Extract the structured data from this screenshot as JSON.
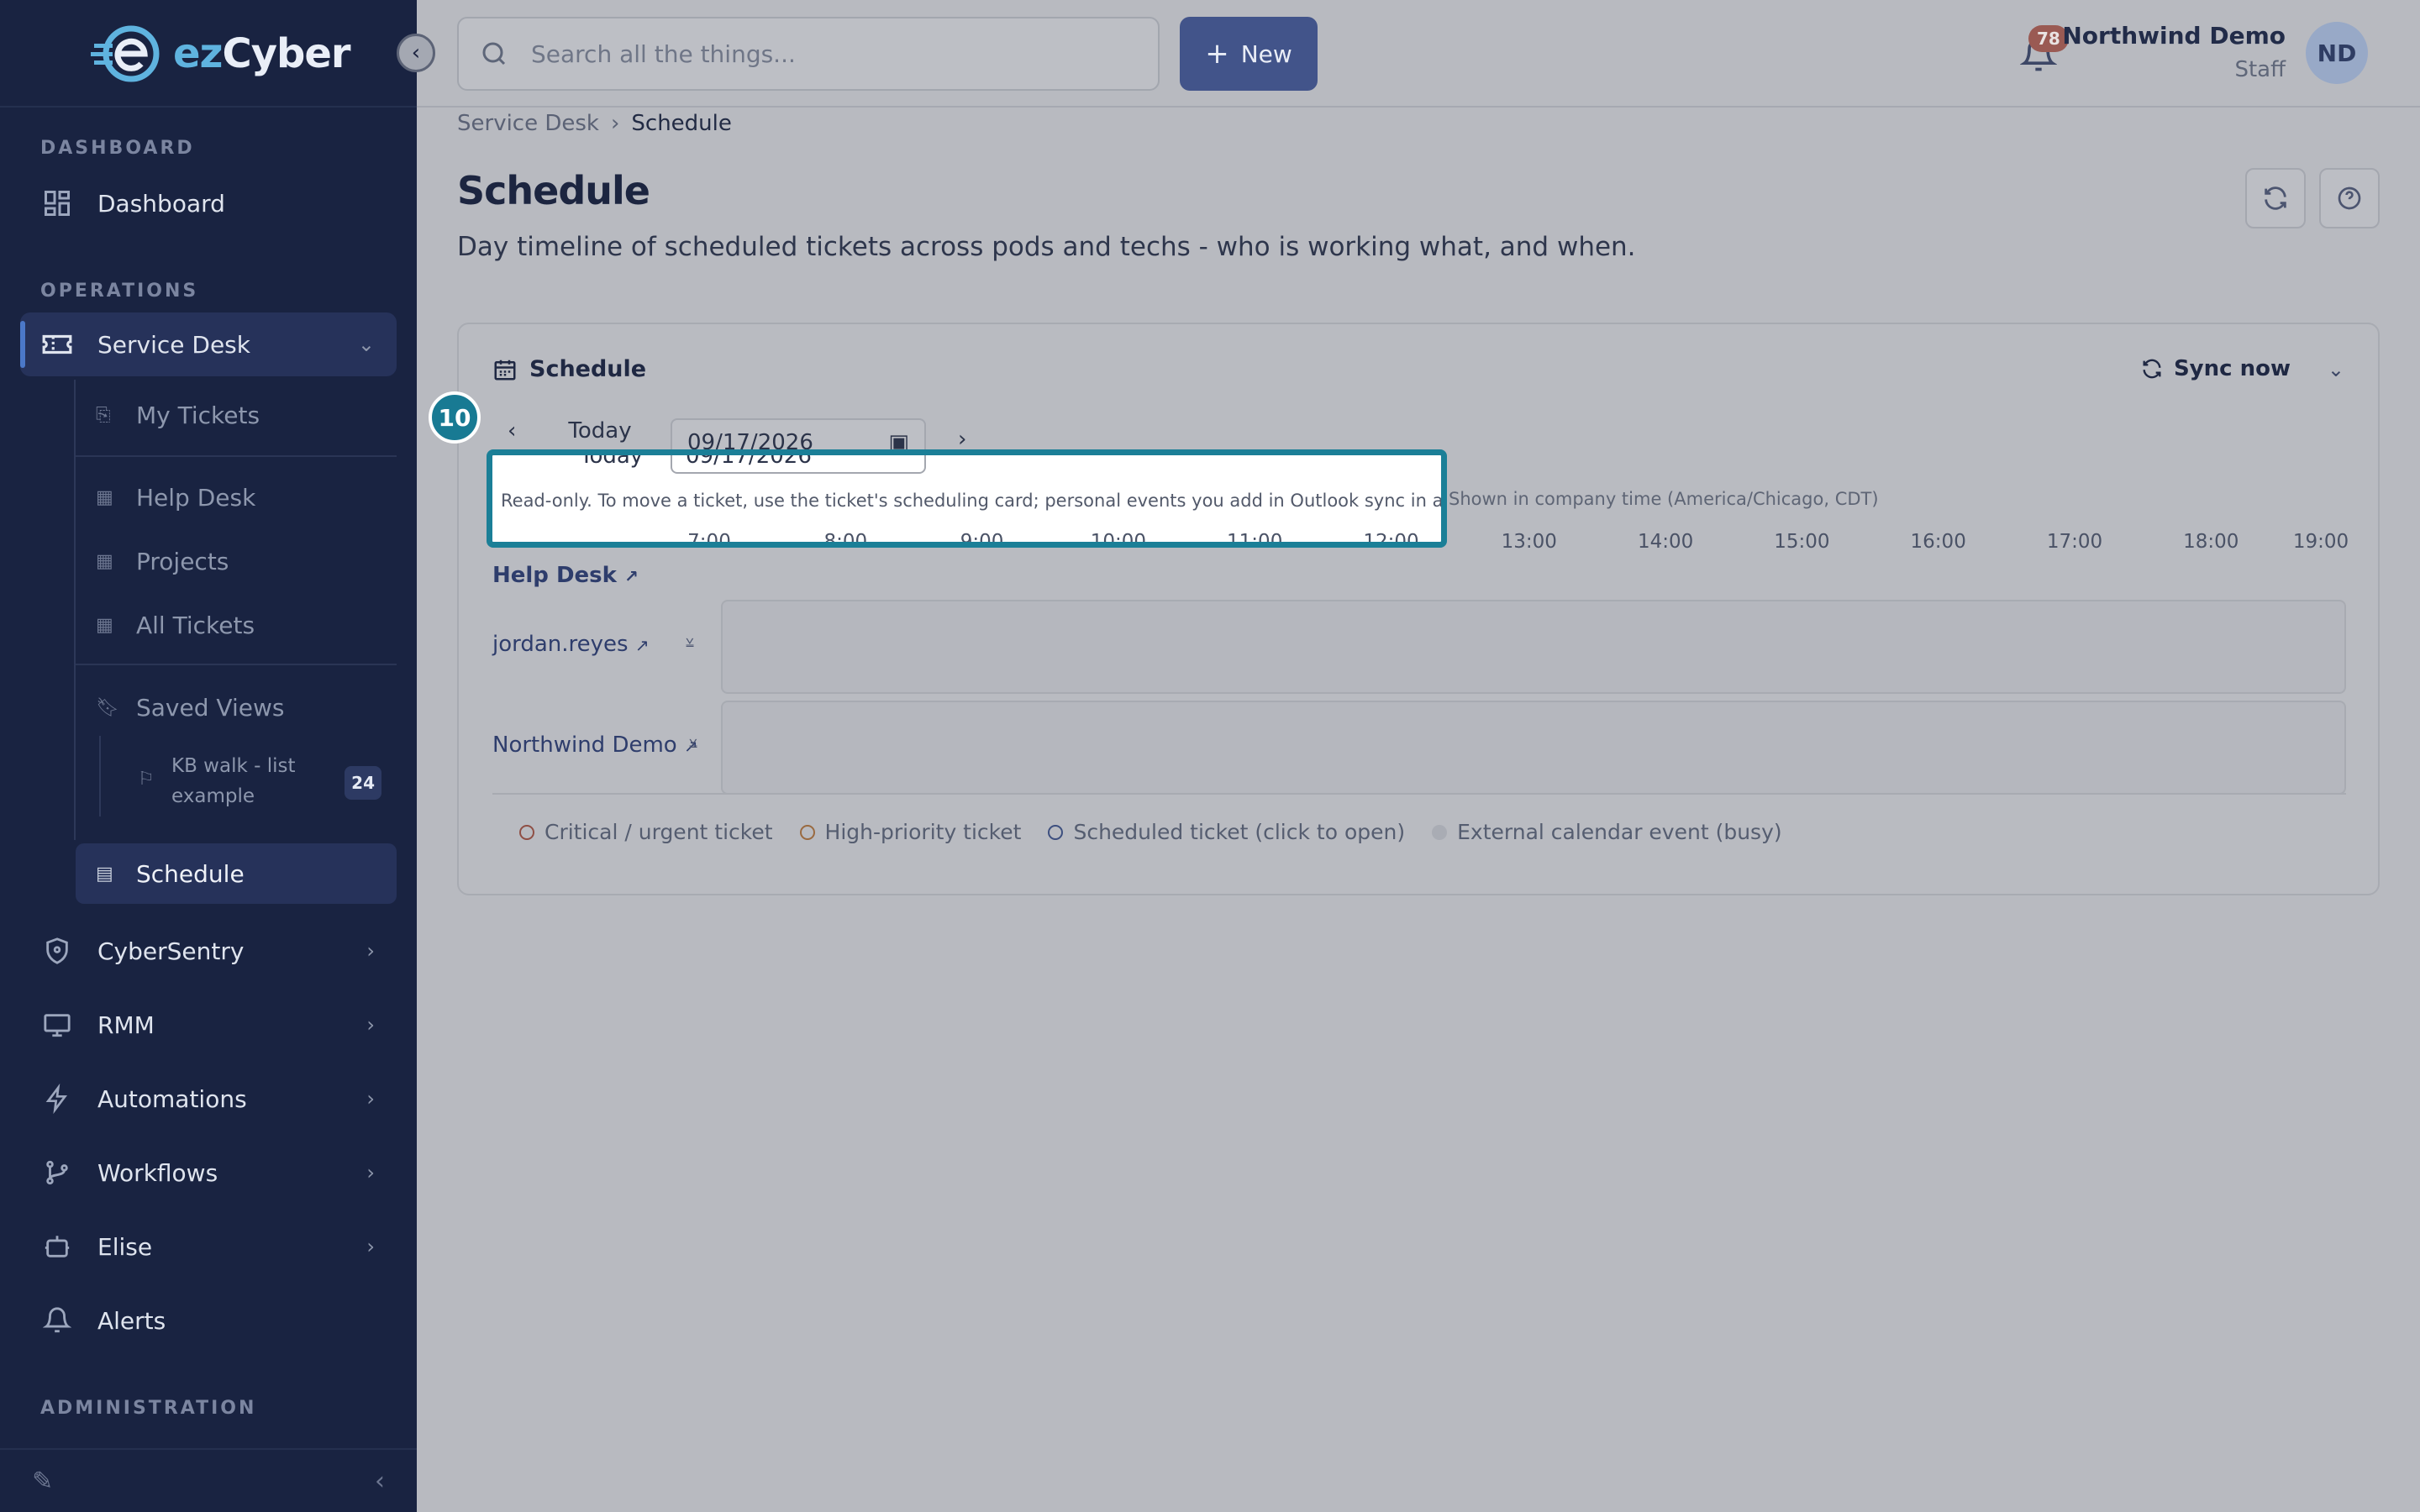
{
  "brand": {
    "ez": "ez",
    "cyber": "Cyber"
  },
  "sidebar": {
    "sections": {
      "dashboard": "DASHBOARD",
      "operations": "OPERATIONS",
      "administration": "ADMINISTRATION"
    },
    "dashboard": "Dashboard",
    "service_desk": "Service Desk",
    "sub_items": {
      "my_tickets": "My Tickets",
      "help_desk": "Help Desk",
      "projects": "Projects",
      "all_tickets": "All Tickets",
      "saved_views": "Saved Views",
      "kb_walk": "KB walk - list example",
      "kb_walk_count": "24",
      "schedule": "Schedule"
    },
    "groups": {
      "cybersentry": "CyberSentry",
      "rmm": "RMM",
      "automations": "Automations",
      "workflows": "Workflows",
      "elise": "Elise",
      "alerts": "Alerts"
    }
  },
  "topbar": {
    "search_placeholder": "Search all the things...",
    "new_label": "New",
    "notifications_count": "78",
    "user_name": "Northwind Demo",
    "user_role": "Staff",
    "user_initials": "ND"
  },
  "breadcrumb": {
    "parent": "Service Desk",
    "current": "Schedule"
  },
  "page": {
    "title": "Schedule",
    "description": "Day timeline of scheduled tickets across pods and techs - who is working what, and when."
  },
  "card": {
    "title": "Schedule",
    "sync_label": "Sync now",
    "today_label": "Today",
    "date_value": "09/17/2026",
    "readonly_note": "Read-only. To move a ticket, use the ticket's scheduling card; personal events you add in Outlook sync in automatically.",
    "timezone_note": "Shown in company time (America/Chicago, CDT)",
    "hours": [
      "7:00",
      "8:00",
      "9:00",
      "10:00",
      "11:00",
      "12:00",
      "13:00",
      "14:00",
      "15:00",
      "16:00",
      "17:00",
      "18:00",
      "19:00"
    ],
    "pod": "Help Desk",
    "techs": [
      "jordan.reyes",
      "Northwind Demo"
    ],
    "legend": {
      "critical": "Critical / urgent ticket",
      "high": "High-priority ticket",
      "scheduled": "Scheduled ticket (click to open)",
      "external": "External calendar event (busy)"
    },
    "legend_colors": {
      "critical": "#8f4f45",
      "high": "#9a6a40",
      "scheduled": "#3d4f7f",
      "external": "#a9acb4"
    }
  },
  "tutorial": {
    "step": "10"
  }
}
